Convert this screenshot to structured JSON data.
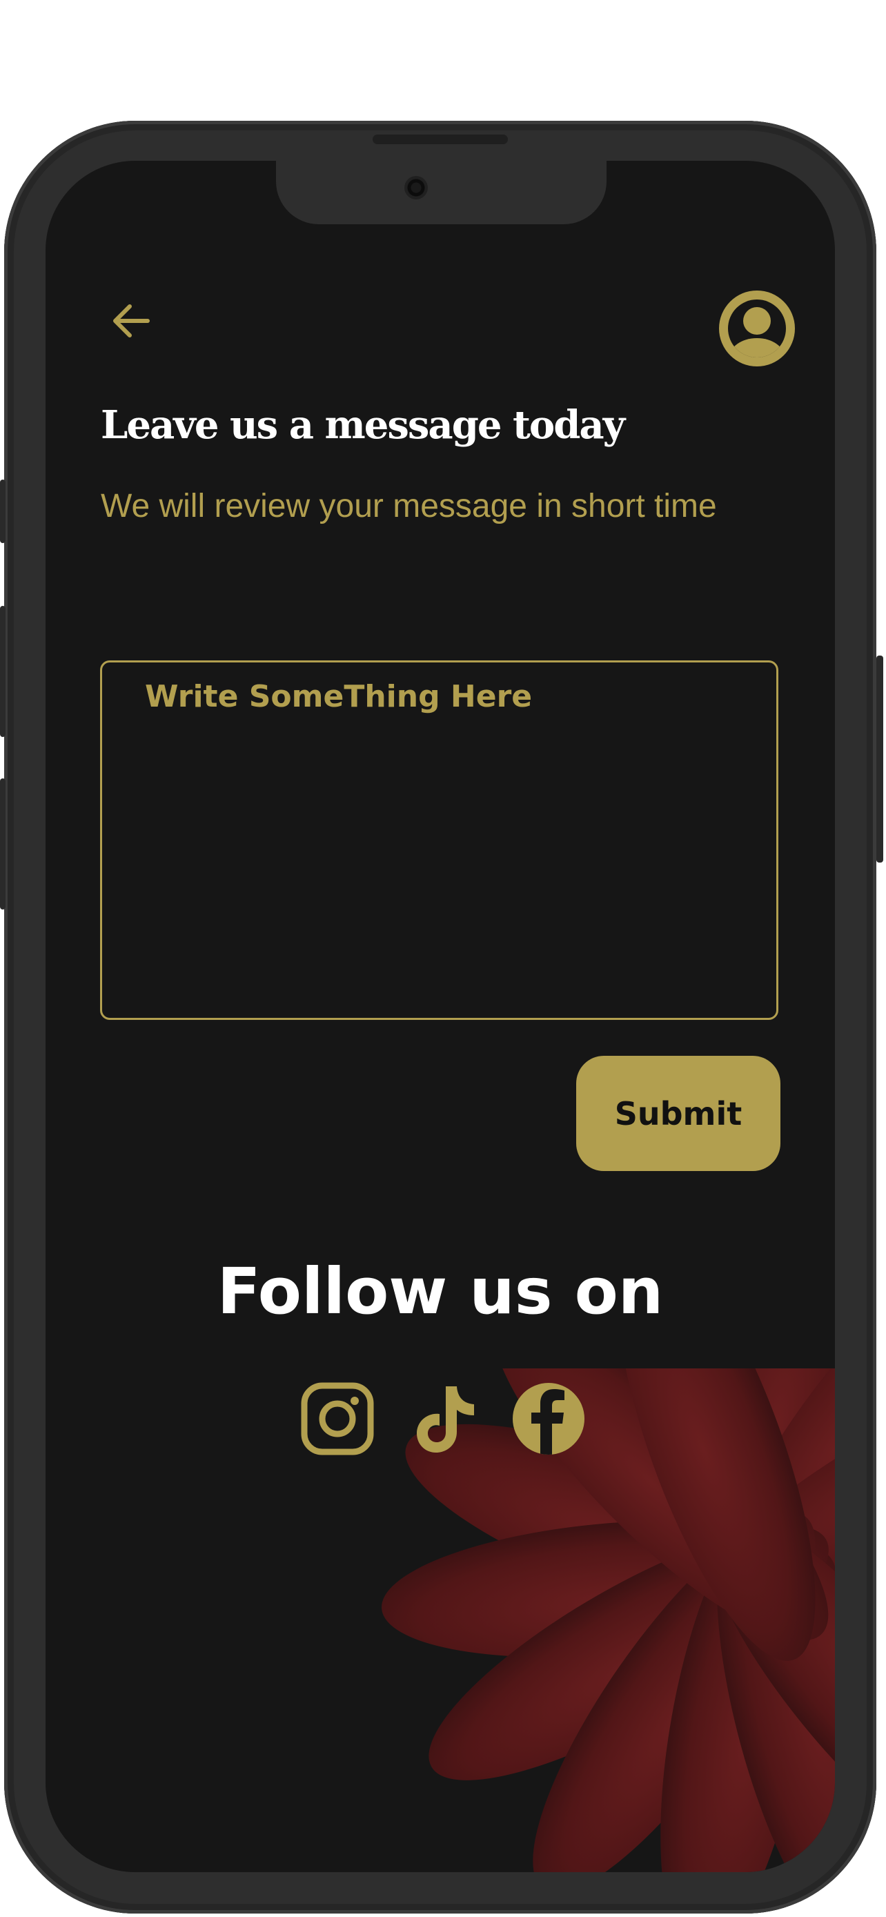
{
  "header": {
    "back_icon": "arrow-left-icon",
    "profile_icon": "user-circle-icon"
  },
  "content": {
    "title": "Leave us a message today",
    "subtitle": "We will review your message in short time",
    "message_placeholder": "Write SomeThing Here",
    "submit_label": "Submit"
  },
  "social": {
    "heading": "Follow us on",
    "icons": [
      "instagram-icon",
      "tiktok-icon",
      "facebook-icon"
    ]
  },
  "colors": {
    "background": "#161616",
    "accent": "#b29f4f",
    "text": "#ffffff",
    "decoration": "#5a1718"
  }
}
